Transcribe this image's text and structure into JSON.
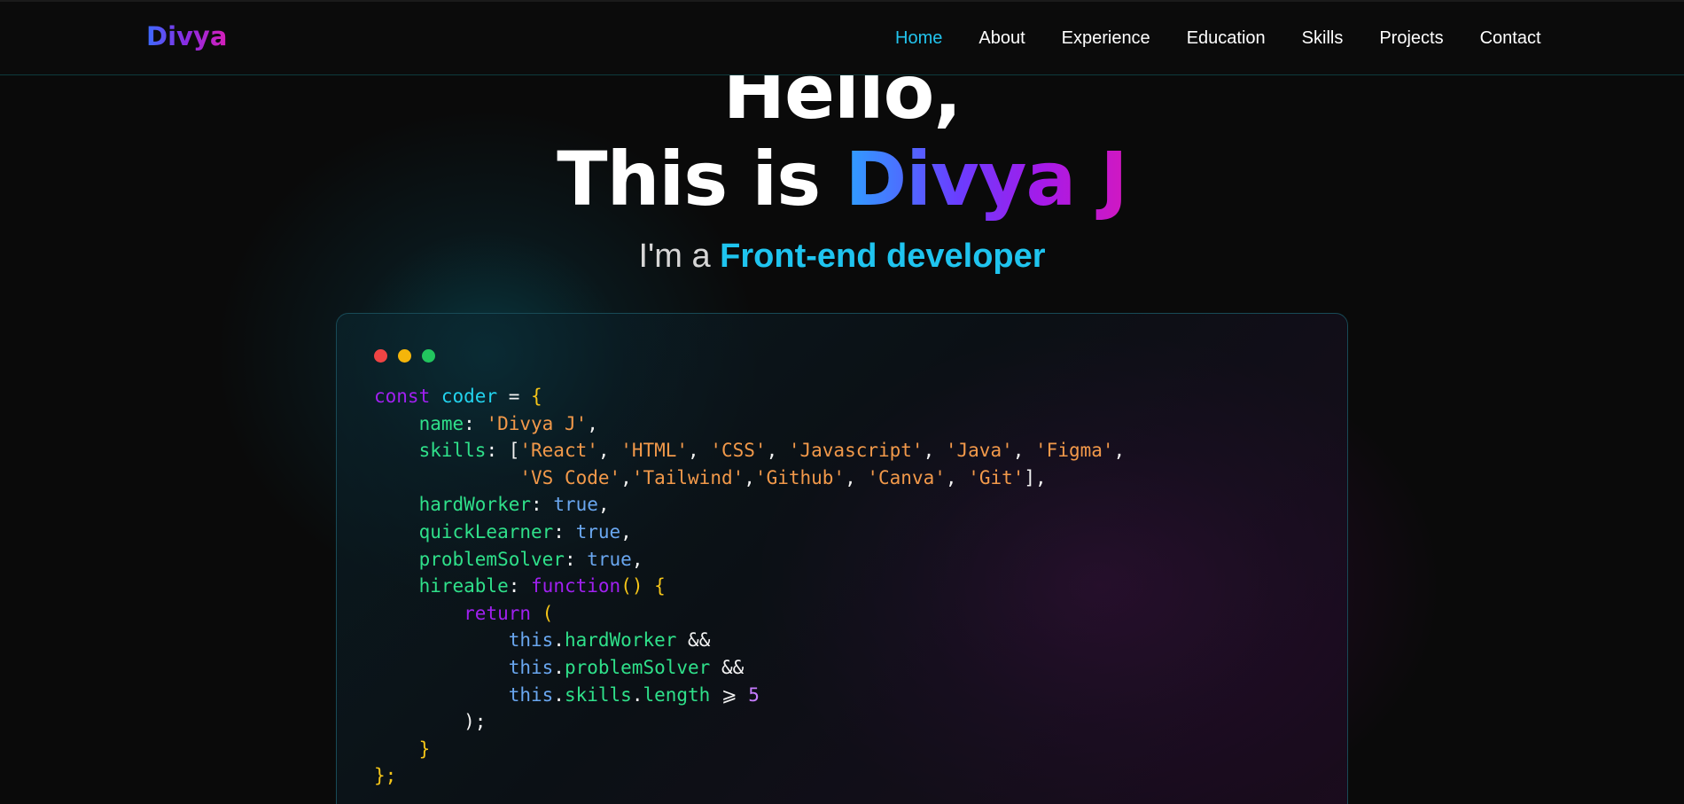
{
  "nav": {
    "logo": "Divya",
    "items": [
      {
        "label": "Home",
        "active": true
      },
      {
        "label": "About",
        "active": false
      },
      {
        "label": "Experience",
        "active": false
      },
      {
        "label": "Education",
        "active": false
      },
      {
        "label": "Skills",
        "active": false
      },
      {
        "label": "Projects",
        "active": false
      },
      {
        "label": "Contact",
        "active": false
      }
    ]
  },
  "hero": {
    "line1": "Hello,",
    "line2_prefix": "This is ",
    "name": "Divya J",
    "subtitle_prefix": "I'm a ",
    "role": "Front-end developer"
  },
  "code": {
    "kw_const": "const",
    "var_name": "coder",
    "eq": " = ",
    "open_brace": "{",
    "name_key": "name",
    "name_val": "'Divya J'",
    "skills_key": "skills",
    "skills_row1": [
      "'React'",
      "'HTML'",
      "'CSS'",
      "'Javascript'",
      "'Java'",
      "'Figma'"
    ],
    "skills_row2": [
      "'VS Code'",
      "'Tailwind'",
      "'Github'",
      "'Canva'",
      "'Git'"
    ],
    "hardworker_key": "hardWorker",
    "quicklearner_key": "quickLearner",
    "problemsolver_key": "problemSolver",
    "true_val": "true",
    "hireable_key": "hireable",
    "kw_function": "function",
    "kw_return": "return",
    "this_kw": "this",
    "cond1": "hardWorker",
    "cond2": "problemSolver",
    "cond3_a": "skills",
    "cond3_b": "length",
    "and_op": "&&",
    "gte_op": "⩾",
    "num_5": "5",
    "close_paren": ");",
    "close_inner": "}",
    "close_outer": "};"
  },
  "colors": {
    "accent_cyan": "#22c4ee",
    "keyword_purple": "#a020f0",
    "string_orange": "#f2994a",
    "key_green": "#2fe08a",
    "bool_blue": "#6aa7f0",
    "brace_yellow": "#f5c518"
  }
}
